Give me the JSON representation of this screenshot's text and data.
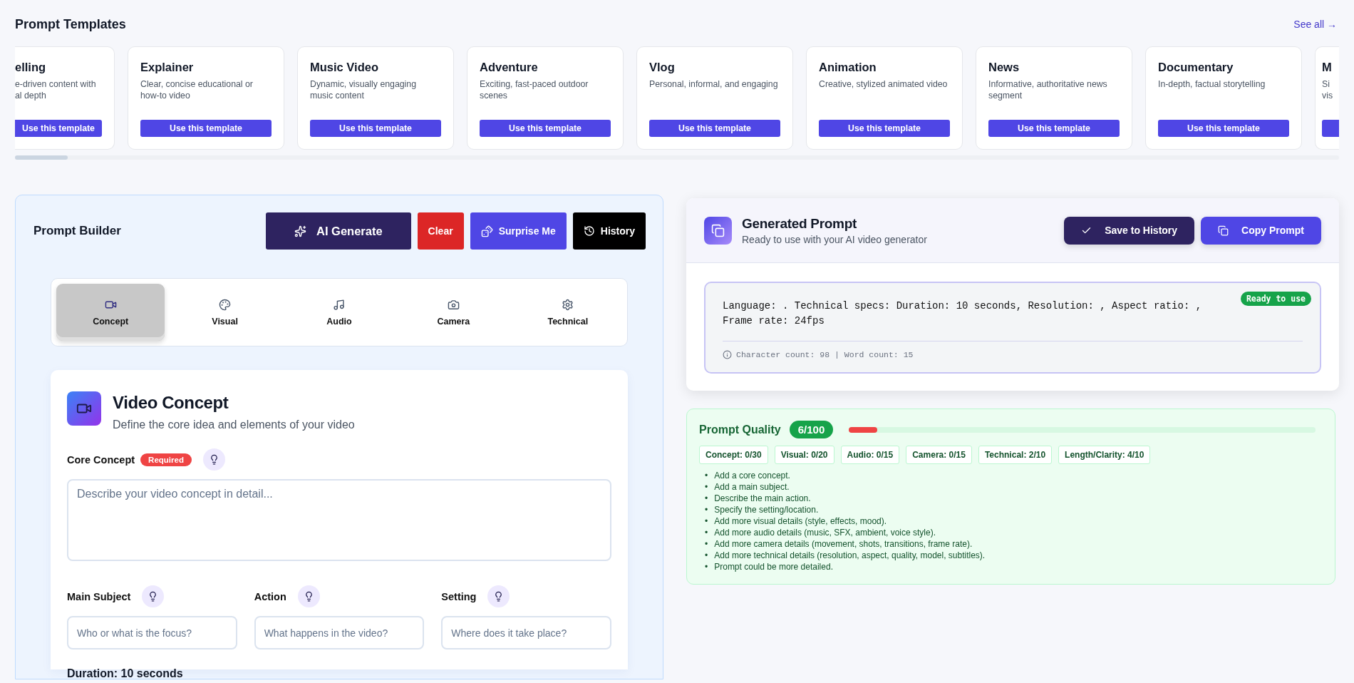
{
  "templates": {
    "title": "Prompt Templates",
    "see_all": "See all →",
    "cards": [
      {
        "kind": "clipped-left",
        "title": "elling",
        "description": "e-driven content with al depth",
        "button": "Use this template"
      },
      {
        "kind": "full",
        "title": "Explainer",
        "description": "Clear, concise educational or how-to video",
        "button": "Use this template"
      },
      {
        "kind": "full",
        "title": "Music Video",
        "description": "Dynamic, visually engaging music content",
        "button": "Use this template"
      },
      {
        "kind": "full",
        "title": "Adventure",
        "description": "Exciting, fast-paced outdoor scenes",
        "button": "Use this template"
      },
      {
        "kind": "full",
        "title": "Vlog",
        "description": "Personal, informal, and engaging",
        "button": "Use this template"
      },
      {
        "kind": "full",
        "title": "Animation",
        "description": "Creative, stylized animated video",
        "button": "Use this template"
      },
      {
        "kind": "full",
        "title": "News",
        "description": "Informative, authoritative news segment",
        "button": "Use this template"
      },
      {
        "kind": "full",
        "title": "Documentary",
        "description": "In-depth, factual storytelling",
        "button": "Use this template"
      },
      {
        "kind": "clipped-right",
        "title": "M",
        "description": "Si vis"
      }
    ]
  },
  "builder": {
    "title": "Prompt Builder",
    "actions": [
      {
        "kind": "generate",
        "label": "AI Generate"
      },
      {
        "kind": "clear",
        "label": "Clear"
      },
      {
        "kind": "surprise",
        "label": "Surprise Me"
      },
      {
        "kind": "history",
        "label": "History"
      }
    ],
    "tabs": [
      {
        "kind": "concept",
        "label": "Concept",
        "selected": true
      },
      {
        "kind": "visual",
        "label": "Visual",
        "selected": false
      },
      {
        "kind": "audio",
        "label": "Audio",
        "selected": false
      },
      {
        "kind": "camera",
        "label": "Camera",
        "selected": false
      },
      {
        "kind": "technical",
        "label": "Technical",
        "selected": false
      }
    ],
    "section": {
      "title": "Video Concept",
      "subtitle": "Define the core idea and elements of your video",
      "core": {
        "label": "Core Concept",
        "badge": "Required",
        "placeholder": "Describe your video concept in detail..."
      },
      "fields": [
        {
          "label": "Main Subject",
          "placeholder": "Who or what is the focus?"
        },
        {
          "label": "Action",
          "placeholder": "What happens in the video?"
        },
        {
          "label": "Setting",
          "placeholder": "Where does it take place?"
        }
      ],
      "duration_label": "Duration: 10 seconds"
    }
  },
  "generated": {
    "title": "Generated Prompt",
    "subtitle": "Ready to use with your AI video generator",
    "actions": [
      {
        "kind": "save",
        "label": "Save to History"
      },
      {
        "kind": "copy",
        "label": "Copy Prompt"
      }
    ],
    "badge": "Ready to use",
    "text": "Language: . Technical specs: Duration: 10 seconds, Resolution: , Aspect ratio: , Frame rate: 24fps",
    "stats": "Character count: 98 | Word count: 15"
  },
  "quality": {
    "title": "Prompt Quality",
    "score": "6/100",
    "level": 0.06,
    "marker": "•",
    "chips": [
      "Concept: 0/30",
      "Visual: 0/20",
      "Audio: 0/15",
      "Camera: 0/15",
      "Technical: 2/10",
      "Length/Clarity: 4/10"
    ],
    "suggestions": [
      "Add a core concept.",
      "Add a main subject.",
      "Describe the main action.",
      "Specify the setting/location.",
      "Add more visual details (style, effects, mood).",
      "Add more audio details (music, SFX, ambient, voice style).",
      "Add more camera details (movement, shots, transitions, frame rate).",
      "Add more technical details (resolution, aspect, quality, model, subtitles).",
      "Prompt could be more detailed."
    ]
  }
}
